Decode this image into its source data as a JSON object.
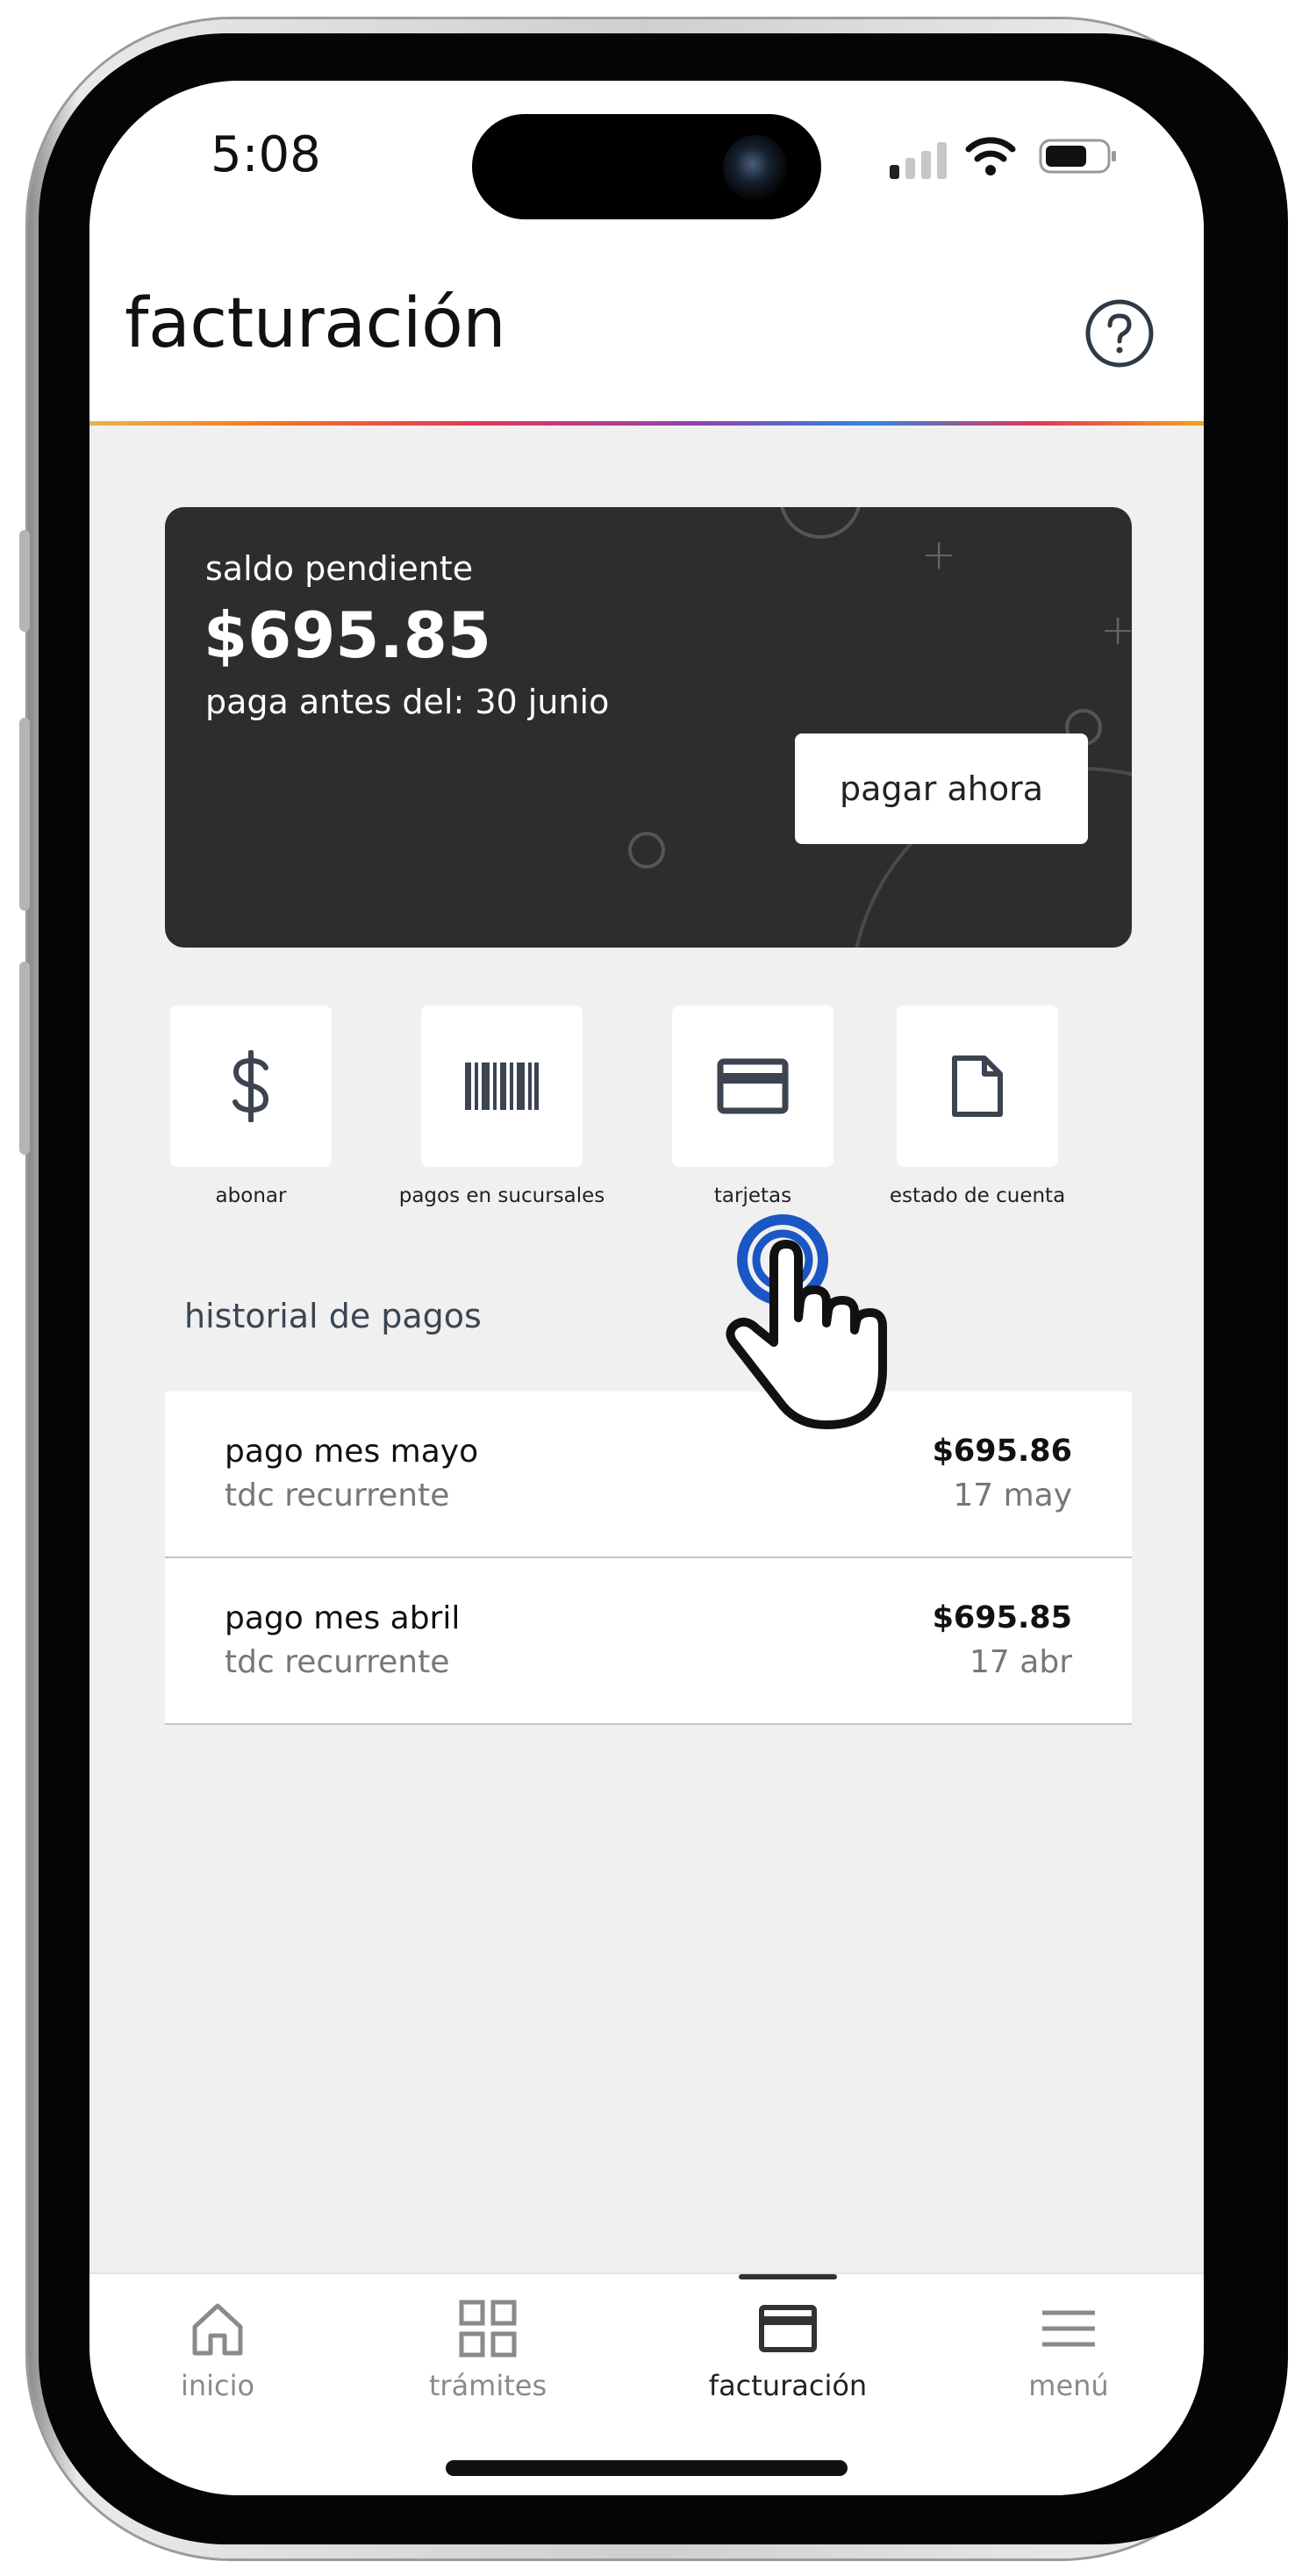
{
  "status_bar": {
    "time": "5:08"
  },
  "header": {
    "title": "facturación",
    "help_icon": "help-circle-icon"
  },
  "balance": {
    "label": "saldo pendiente",
    "amount": "$695.85",
    "due": "paga antes del: 30 junio",
    "pay_button": "pagar ahora",
    "card_color": "#2d2d2d"
  },
  "actions": [
    {
      "label": "abonar",
      "icon": "dollar-icon"
    },
    {
      "label": "pagos en sucursales",
      "icon": "barcode-icon"
    },
    {
      "label": "tarjetas",
      "icon": "credit-card-icon"
    },
    {
      "label": "estado de cuenta",
      "icon": "document-icon"
    }
  ],
  "history": {
    "title": "historial de pagos",
    "items": [
      {
        "description": "pago mes mayo",
        "method": "tdc recurrente",
        "amount": "$695.86",
        "date": "17 may"
      },
      {
        "description": "pago mes abril",
        "method": "tdc recurrente",
        "amount": "$695.85",
        "date": "17 abr"
      }
    ]
  },
  "bottom_nav": {
    "items": [
      {
        "label": "inicio",
        "icon": "home-icon"
      },
      {
        "label": "trámites",
        "icon": "grid-icon"
      },
      {
        "label": "facturación",
        "icon": "credit-card-icon",
        "active": true
      },
      {
        "label": "menú",
        "icon": "hamburger-menu-icon"
      }
    ]
  },
  "colors": {
    "accent_tap": "#1a56c4",
    "text_muted": "#8a8a8a",
    "background": "#f0f0f0"
  }
}
